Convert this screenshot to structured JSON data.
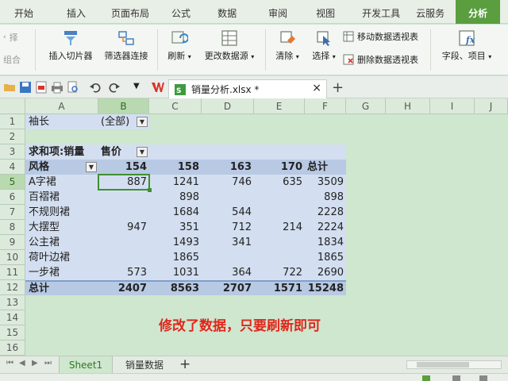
{
  "ribbon_tabs": [
    "开始",
    "插入",
    "页面布局",
    "公式",
    "数据",
    "审阅",
    "视图",
    "开发工具",
    "云服务",
    "分析"
  ],
  "ribbon": {
    "left_cut_1": "择",
    "left_cut_2": "组合",
    "insert_slicer": "插入切片器",
    "filter_connection": "筛选器连接",
    "refresh": "刷新",
    "change_source": "更改数据源",
    "clear": "清除",
    "select": "选择",
    "move_pivot": "移动数据透视表",
    "delete_pivot": "删除数据透视表",
    "fields_items": "字段、项目"
  },
  "file_tab": {
    "name": "销量分析.xlsx *",
    "close": "×",
    "new": "+"
  },
  "columns": [
    "A",
    "B",
    "C",
    "D",
    "E",
    "F",
    "G",
    "H",
    "I",
    "J"
  ],
  "rows": [
    "1",
    "2",
    "3",
    "4",
    "5",
    "6",
    "7",
    "8",
    "9",
    "10",
    "11",
    "12",
    "13",
    "14",
    "15",
    "16"
  ],
  "pivot": {
    "filter_label": "袖长",
    "filter_value": "(全部)",
    "sum_label": "求和项:销量",
    "col_field": "售价",
    "row_field": "风格",
    "headers": [
      "154",
      "158",
      "163",
      "170",
      "总计"
    ],
    "data": [
      {
        "name": "A字裙",
        "v": [
          "887",
          "1241",
          "746",
          "635",
          "3509"
        ]
      },
      {
        "name": "百褶裙",
        "v": [
          "",
          "898",
          "",
          "",
          "898"
        ]
      },
      {
        "name": "不规则裙",
        "v": [
          "",
          "1684",
          "544",
          "",
          "2228"
        ]
      },
      {
        "name": "大摆型",
        "v": [
          "947",
          "351",
          "712",
          "214",
          "2224"
        ]
      },
      {
        "name": "公主裙",
        "v": [
          "",
          "1493",
          "341",
          "",
          "1834"
        ]
      },
      {
        "name": "荷叶边裙",
        "v": [
          "",
          "1865",
          "",
          "",
          "1865"
        ]
      },
      {
        "name": "一步裙",
        "v": [
          "573",
          "1031",
          "364",
          "722",
          "2690"
        ]
      }
    ],
    "total_label": "总计",
    "totals": [
      "2407",
      "8563",
      "2707",
      "1571",
      "15248"
    ]
  },
  "annotation": "修改了数据，只要刷新即可",
  "sheets": [
    "Sheet1",
    "销量数据"
  ],
  "add_sheet": "+",
  "colors": {
    "accent": "#5a9e3f",
    "annotation": "#e0271b",
    "pivot_bg": "#d3dff0",
    "pivot_header": "#b8c9e4"
  }
}
